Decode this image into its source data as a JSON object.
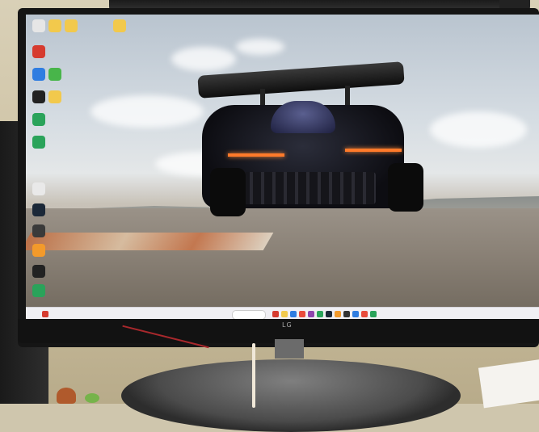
{
  "scene": {
    "monitor_brand_logo": "LG"
  },
  "desktop": {
    "icons": [
      {
        "name": "recycle-bin-icon",
        "color": "#e6e6e6"
      },
      {
        "name": "folder-icon",
        "color": "#f2c94c"
      },
      {
        "name": "folder-icon",
        "color": "#f2c94c"
      },
      {
        "name": "folder-icon",
        "color": "#f2c94c"
      },
      {
        "name": "chrome-icon",
        "color": "#d63b2f"
      },
      {
        "name": "edge-icon",
        "color": "#2f7de1"
      },
      {
        "name": "app-icon",
        "color": "#48b54a"
      },
      {
        "name": "app-icon",
        "color": "#222222"
      },
      {
        "name": "app-icon",
        "color": "#f2c94c"
      },
      {
        "name": "app-icon",
        "color": "#2aa35a"
      },
      {
        "name": "app-icon",
        "color": "#2aa35a"
      },
      {
        "name": "app-icon",
        "color": "#e9e9e9"
      },
      {
        "name": "steam-icon",
        "color": "#1b2838"
      },
      {
        "name": "app-icon",
        "color": "#3a3a3a"
      },
      {
        "name": "app-icon",
        "color": "#f39a2b"
      },
      {
        "name": "app-icon",
        "color": "#222222"
      },
      {
        "name": "app-icon",
        "color": "#2aa35a"
      }
    ]
  },
  "taskbar": {
    "pinned_icon_colors": [
      "#d63b2f",
      "#f2c94c",
      "#2f7de1",
      "#e94b3c",
      "#8e44ad",
      "#2aa35a",
      "#1b2838",
      "#f39a2b",
      "#333333",
      "#2f7de1",
      "#e94b3c",
      "#2aa35a"
    ]
  }
}
